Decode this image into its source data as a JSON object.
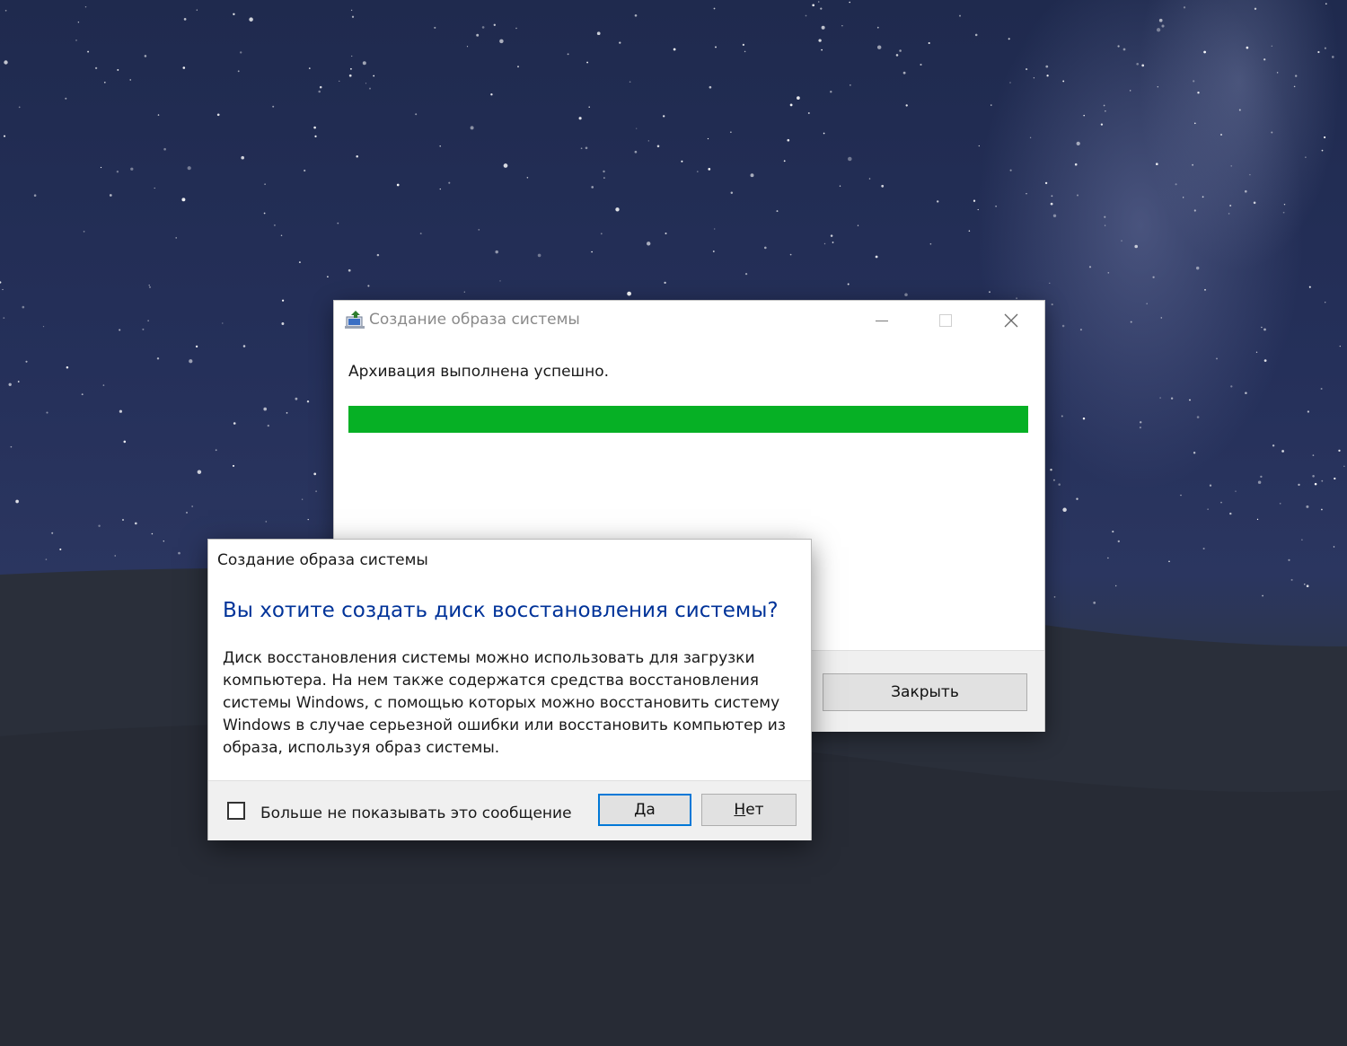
{
  "main_window": {
    "title": "Создание образа системы",
    "status_text": "Архивация выполнена успешно.",
    "progress_fraction": 1.0,
    "progress_color": "#06b025",
    "close_button_label": "Закрыть",
    "controls": {
      "minimize_icon": "minimize-icon",
      "maximize_icon": "maximize-icon",
      "close_icon": "close-icon"
    }
  },
  "dialog": {
    "title": "Создание образа системы",
    "heading": "Вы хотите создать диск восстановления системы?",
    "heading_color": "#003399",
    "body_lines": [
      "Диск восстановления системы можно использовать для загрузки",
      "компьютера. На нем также содержатся средства восстановления",
      "системы Windows, с помощью которых можно восстановить систему",
      "Windows в случае серьезной ошибки или восстановить компьютер из",
      "образа, используя образ системы."
    ],
    "checkbox_label": "Больше не показывать это сообщение",
    "checkbox_checked": false,
    "yes_mnemonic": "Д",
    "yes_rest": "а",
    "no_mnemonic": "Н",
    "no_rest": "ет"
  }
}
